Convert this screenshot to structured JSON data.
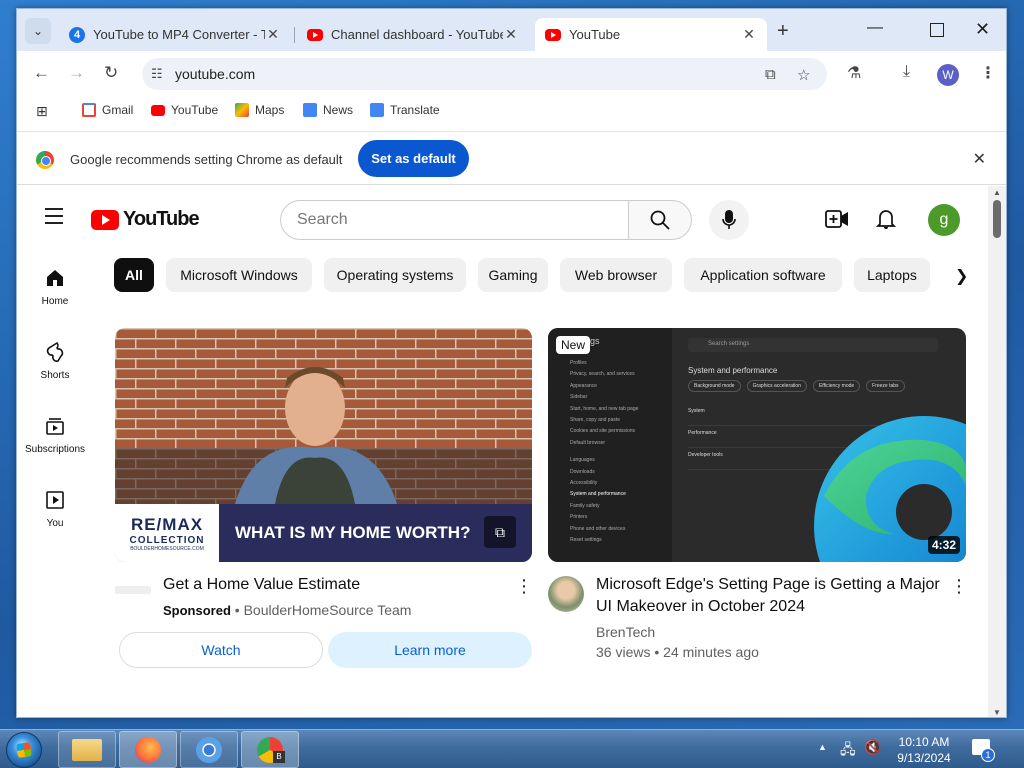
{
  "tabs": [
    {
      "badge": "4",
      "title": "YouTube to MP4 Converter - Tu",
      "active": false
    },
    {
      "title": "Channel dashboard - YouTube",
      "active": false
    },
    {
      "title": "YouTube",
      "active": true
    }
  ],
  "toolbar": {
    "url": "youtube.com",
    "profile_initial": "W"
  },
  "bookmarks": [
    {
      "label": "Gmail",
      "icon": "gmail-icon",
      "color": "#ea4335"
    },
    {
      "label": "YouTube",
      "icon": "youtube-icon",
      "color": "#ff0000"
    },
    {
      "label": "Maps",
      "icon": "maps-icon",
      "color": "#34a853"
    },
    {
      "label": "News",
      "icon": "news-icon",
      "color": "#4285f4"
    },
    {
      "label": "Translate",
      "icon": "translate-icon",
      "color": "#4285f4"
    }
  ],
  "infobar": {
    "message": "Google recommends setting Chrome as default",
    "button": "Set as default"
  },
  "youtube": {
    "logo_text": "YouTube",
    "search_placeholder": "Search",
    "account_initial": "g",
    "sidenav": [
      {
        "label": "Home",
        "icon": "home-icon"
      },
      {
        "label": "Shorts",
        "icon": "shorts-icon"
      },
      {
        "label": "Subscriptions",
        "icon": "subscriptions-icon"
      },
      {
        "label": "You",
        "icon": "you-icon"
      }
    ],
    "chips": [
      "All",
      "Microsoft Windows",
      "Operating systems",
      "Gaming",
      "Web browser",
      "Application software",
      "Laptops"
    ],
    "ad": {
      "title": "Get a Home Value Estimate",
      "sponsored": "Sponsored",
      "advertiser": "BoulderHomeSource Team",
      "banner_text": "WHAT IS MY HOME WORTH?",
      "brand_line1": "RE/MAX",
      "brand_line2": "COLLECTION",
      "brand_url": "BOULDERHOMESOURCE.COM",
      "watch_label": "Watch",
      "learn_label": "Learn more"
    },
    "video": {
      "badge": "New",
      "title_line1": "Microsoft Edge's Setting Page is Getting a Major",
      "title_line2": "UI Makeover in October 2024",
      "channel": "BrenTech",
      "views": "36 views",
      "age": "24 minutes ago",
      "duration": "4:32",
      "settings_heading": "System and performance",
      "settings_search": "Search settings",
      "settings_title_fragment": "gs",
      "settings_menu": [
        "Profiles",
        "Privacy, search, and services",
        "Appearance",
        "Sidebar",
        "Start, home, and new tab page",
        "Share, copy and paste",
        "Cookies and site permissions",
        "Default browser",
        "Languages",
        "Downloads",
        "Accessibility",
        "System and performance",
        "Family safety",
        "Printers",
        "Phone and other devices",
        "Reset settings"
      ],
      "settings_chips": [
        "Background mode",
        "Graphics acceleration",
        "Efficiency mode",
        "Freeze tabs"
      ],
      "settings_rows": [
        "System",
        "Performance",
        "Developer tools"
      ]
    }
  },
  "taskbar": {
    "time": "10:10 AM",
    "date": "9/13/2024",
    "notifications": "1"
  }
}
